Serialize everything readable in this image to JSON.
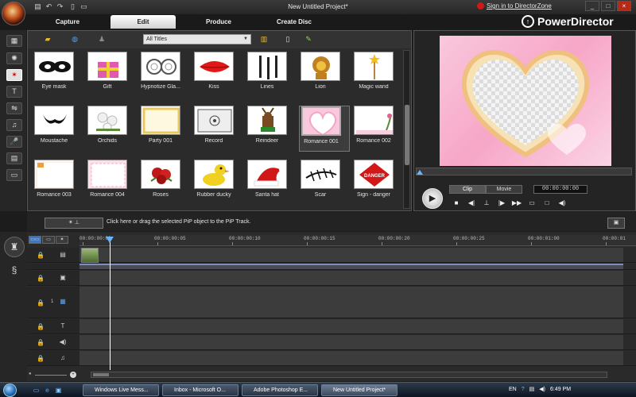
{
  "window": {
    "title": "New Untitled Project*",
    "signin_label": "Sign in to DirectorZone",
    "brand": "PowerDirector",
    "controls": [
      "_",
      "□",
      "×"
    ]
  },
  "quick_access": [
    "save-icon",
    "undo-icon",
    "redo-icon",
    "new-icon",
    "open-icon"
  ],
  "tabs": [
    {
      "label": "Capture",
      "active": false
    },
    {
      "label": "Edit",
      "active": true
    },
    {
      "label": "Produce",
      "active": false
    },
    {
      "label": "Create Disc",
      "active": false
    }
  ],
  "library": {
    "filter_selected": "All Titles",
    "items": [
      {
        "label": "Eye mask",
        "kind": "eyemask"
      },
      {
        "label": "Gift",
        "kind": "gift"
      },
      {
        "label": "Hypnotize Gla...",
        "kind": "glasses"
      },
      {
        "label": "Kiss",
        "kind": "kiss"
      },
      {
        "label": "Lines",
        "kind": "lines"
      },
      {
        "label": "Lion",
        "kind": "lion"
      },
      {
        "label": "Magic wand",
        "kind": "wand"
      },
      {
        "label": "Moustache",
        "kind": "moustache"
      },
      {
        "label": "Orchids",
        "kind": "orchids"
      },
      {
        "label": "Party 001",
        "kind": "party"
      },
      {
        "label": "Record",
        "kind": "record"
      },
      {
        "label": "Reindeer",
        "kind": "reindeer"
      },
      {
        "label": "Romance 001",
        "kind": "romance001",
        "selected": true
      },
      {
        "label": "Romance 002",
        "kind": "romance002"
      },
      {
        "label": "Romance 003",
        "kind": "romance003"
      },
      {
        "label": "Romance 004",
        "kind": "romance004"
      },
      {
        "label": "Roses",
        "kind": "roses"
      },
      {
        "label": "Rubber ducky",
        "kind": "duck"
      },
      {
        "label": "Santa hat",
        "kind": "santa"
      },
      {
        "label": "Scar",
        "kind": "scar"
      },
      {
        "label": "Sign - danger",
        "kind": "danger",
        "sign_text": "DANGER"
      }
    ]
  },
  "preview": {
    "mode_clip": "Clip",
    "mode_movie": "Movie",
    "timecode": "00:00:00:00"
  },
  "pip": {
    "hint": "Click here or drag the selected PiP object to the PiP Track."
  },
  "timeline": {
    "ruler_ticks": [
      "00:00:00:00",
      "00:00:00:05",
      "00:00:00:10",
      "00:00:00:15",
      "00:00:00:20",
      "00:00:00:25",
      "00:00:01:00",
      "00:00:01"
    ],
    "pip_track_number": "1"
  },
  "taskbar": {
    "tasks": [
      {
        "label": "Windows Live Mess...",
        "active": false
      },
      {
        "label": "Inbox - Microsoft O...",
        "active": false
      },
      {
        "label": "Adobe Photoshop E...",
        "active": false
      },
      {
        "label": "New Untitled Project*",
        "active": true
      }
    ],
    "language": "EN",
    "clock": "6:49 PM"
  }
}
